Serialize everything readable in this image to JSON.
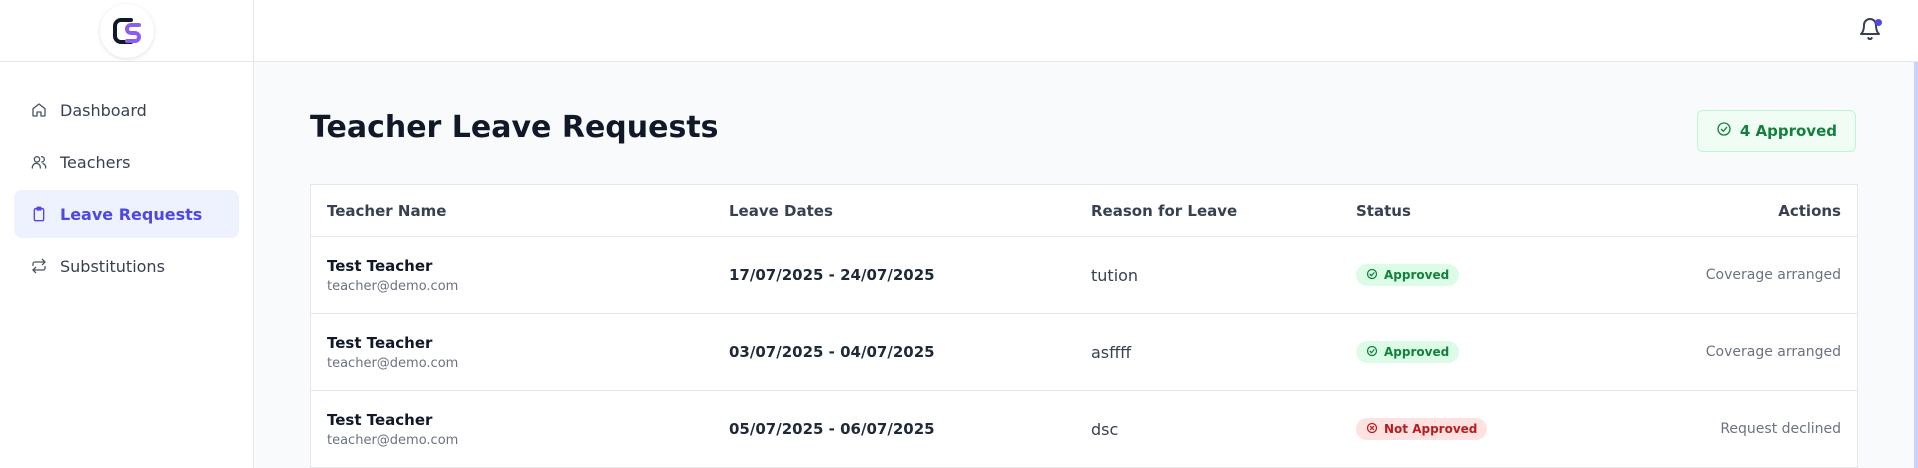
{
  "sidebar": {
    "logo_icon": "cs-logo",
    "items": [
      {
        "label": "Dashboard",
        "icon": "home-icon",
        "active": false
      },
      {
        "label": "Teachers",
        "icon": "users-icon",
        "active": false
      },
      {
        "label": "Leave Requests",
        "icon": "clipboard-icon",
        "active": true
      },
      {
        "label": "Substitutions",
        "icon": "repeat-icon",
        "active": false
      }
    ]
  },
  "topbar": {
    "notification_icon": "bell-icon"
  },
  "page": {
    "title": "Teacher Leave Requests",
    "approved_summary": "4 Approved"
  },
  "table": {
    "headers": {
      "name": "Teacher Name",
      "dates": "Leave Dates",
      "reason": "Reason for Leave",
      "status": "Status",
      "actions": "Actions"
    },
    "rows": [
      {
        "name": "Test Teacher",
        "email": "teacher@demo.com",
        "dates": "17/07/2025 - 24/07/2025",
        "reason": "tution",
        "status": "Approved",
        "action": "Coverage arranged"
      },
      {
        "name": "Test Teacher",
        "email": "teacher@demo.com",
        "dates": "03/07/2025 - 04/07/2025",
        "reason": "asffff",
        "status": "Approved",
        "action": "Coverage arranged"
      },
      {
        "name": "Test Teacher",
        "email": "teacher@demo.com",
        "dates": "05/07/2025 - 06/07/2025",
        "reason": "dsc",
        "status": "Not Approved",
        "action": "Request declined"
      }
    ]
  },
  "colors": {
    "accent": "#4f46e5",
    "approved": "#15803d",
    "declined": "#b91c1c"
  }
}
